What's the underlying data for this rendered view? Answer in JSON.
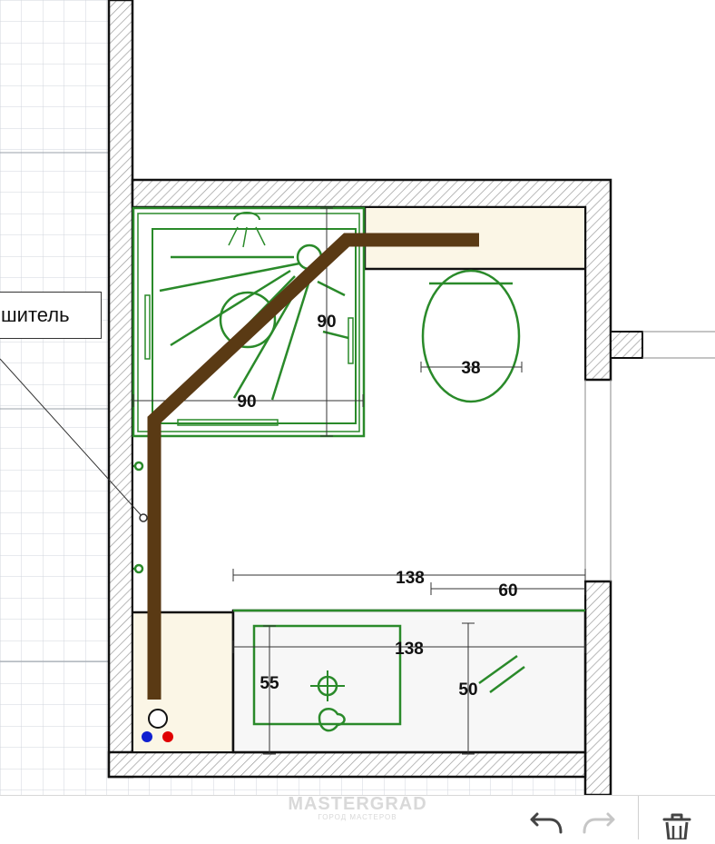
{
  "callout": {
    "label": "шитель"
  },
  "dimensions": {
    "shower_width": "90",
    "shower_depth": "90",
    "toilet_width": "38",
    "wall_length": "138",
    "offset": "60",
    "vanity_length": "138",
    "sink_depth": "55",
    "vanity_depth": "50"
  },
  "watermark": {
    "brand": "MASTERGRAD",
    "tagline": "ГОРОД МАСТЕРОВ"
  },
  "toolbar": {
    "undo_icon": "undo-icon",
    "redo_icon": "redo-icon",
    "delete_icon": "trash-icon"
  },
  "colors": {
    "fixture_green": "#2a8a2a",
    "pipe_brown": "#5a3a14",
    "wall_black": "#111111",
    "cream_fill": "#fbf6e6",
    "hot_water": "#e00000",
    "cold_water": "#1020d0"
  }
}
